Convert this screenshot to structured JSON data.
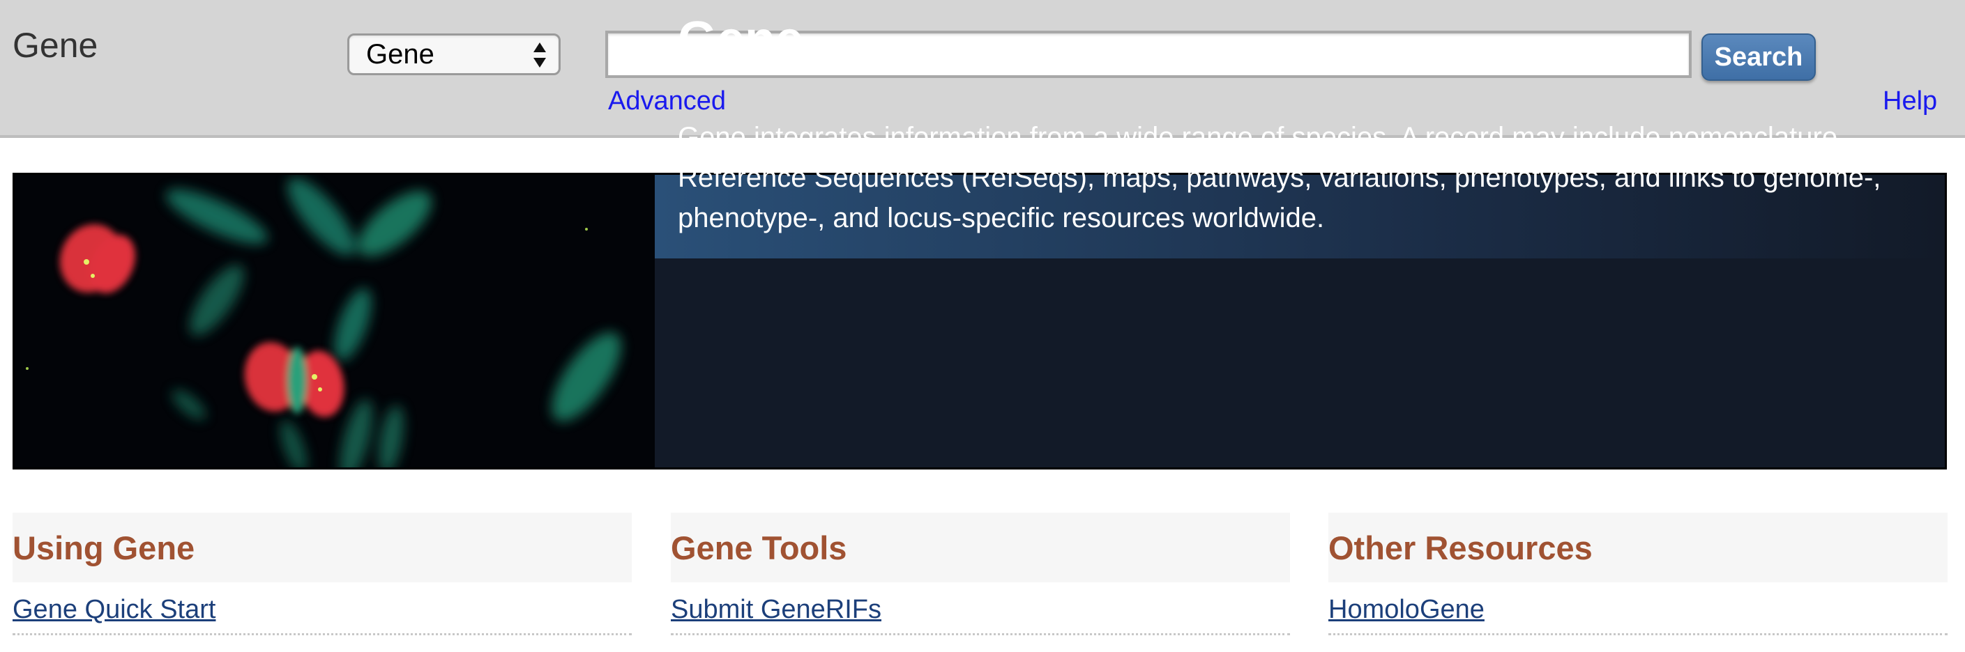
{
  "header": {
    "db_title": "Gene",
    "db_select": {
      "selected": "Gene"
    },
    "search": {
      "value": ""
    },
    "search_button_label": "Search",
    "advanced_label": "Advanced",
    "help_label": "Help"
  },
  "banner": {
    "title": "Gene",
    "description": "Gene integrates information from a wide range of species. A record may include nomenclature, Reference Sequences (RefSeqs), maps, pathways, variations, phenotypes, and links to genome-, phenotype-, and locus-specific resources worldwide."
  },
  "columns": [
    {
      "heading": "Using Gene",
      "links": [
        "Gene Quick Start"
      ]
    },
    {
      "heading": "Gene Tools",
      "links": [
        "Submit GeneRIFs"
      ]
    },
    {
      "heading": "Other Resources",
      "links": [
        "HomoloGene"
      ]
    }
  ],
  "colors": {
    "header_bg": "#d5d5d5",
    "link": "#1a1aee",
    "button": "#4a7bb2",
    "banner_bg": "#121a28",
    "section_heading": "#a05232",
    "section_link": "#1c3f7a"
  }
}
